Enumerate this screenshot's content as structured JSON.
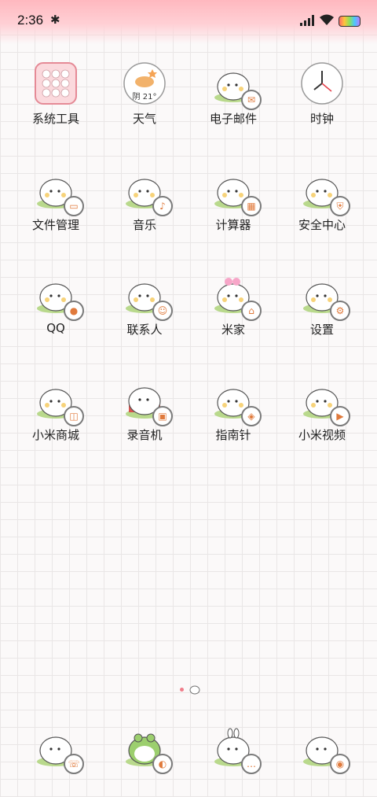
{
  "status": {
    "time": "2:36",
    "bluetooth_icon": "bluetooth-icon",
    "signal_icon": "signal-icon",
    "wifi_icon": "wifi-icon",
    "battery_icon": "battery-icon"
  },
  "colors": {
    "accent": "#f7a6b0",
    "grid": "#e9e6e6",
    "badge_orange": "#e07a3c"
  },
  "apps": [
    {
      "label": "系统工具",
      "icon": "tools-folder-icon"
    },
    {
      "label": "天气",
      "icon": "weather-icon",
      "temp": "阴 21°"
    },
    {
      "label": "电子邮件",
      "icon": "mail-icon"
    },
    {
      "label": "时钟",
      "icon": "clock-icon"
    },
    {
      "label": "文件管理",
      "icon": "folder-icon"
    },
    {
      "label": "音乐",
      "icon": "music-icon"
    },
    {
      "label": "计算器",
      "icon": "calculator-icon"
    },
    {
      "label": "安全中心",
      "icon": "shield-icon"
    },
    {
      "label": "QQ",
      "icon": "qq-icon"
    },
    {
      "label": "联系人",
      "icon": "contacts-icon"
    },
    {
      "label": "米家",
      "icon": "home-icon"
    },
    {
      "label": "设置",
      "icon": "gear-icon"
    },
    {
      "label": "小米商城",
      "icon": "shop-icon"
    },
    {
      "label": "录音机",
      "icon": "recorder-icon"
    },
    {
      "label": "指南针",
      "icon": "compass-icon"
    },
    {
      "label": "小米视频",
      "icon": "video-icon"
    }
  ],
  "dock": [
    {
      "icon": "phone-icon"
    },
    {
      "icon": "browser-icon"
    },
    {
      "icon": "message-icon"
    },
    {
      "icon": "camera-icon"
    }
  ]
}
